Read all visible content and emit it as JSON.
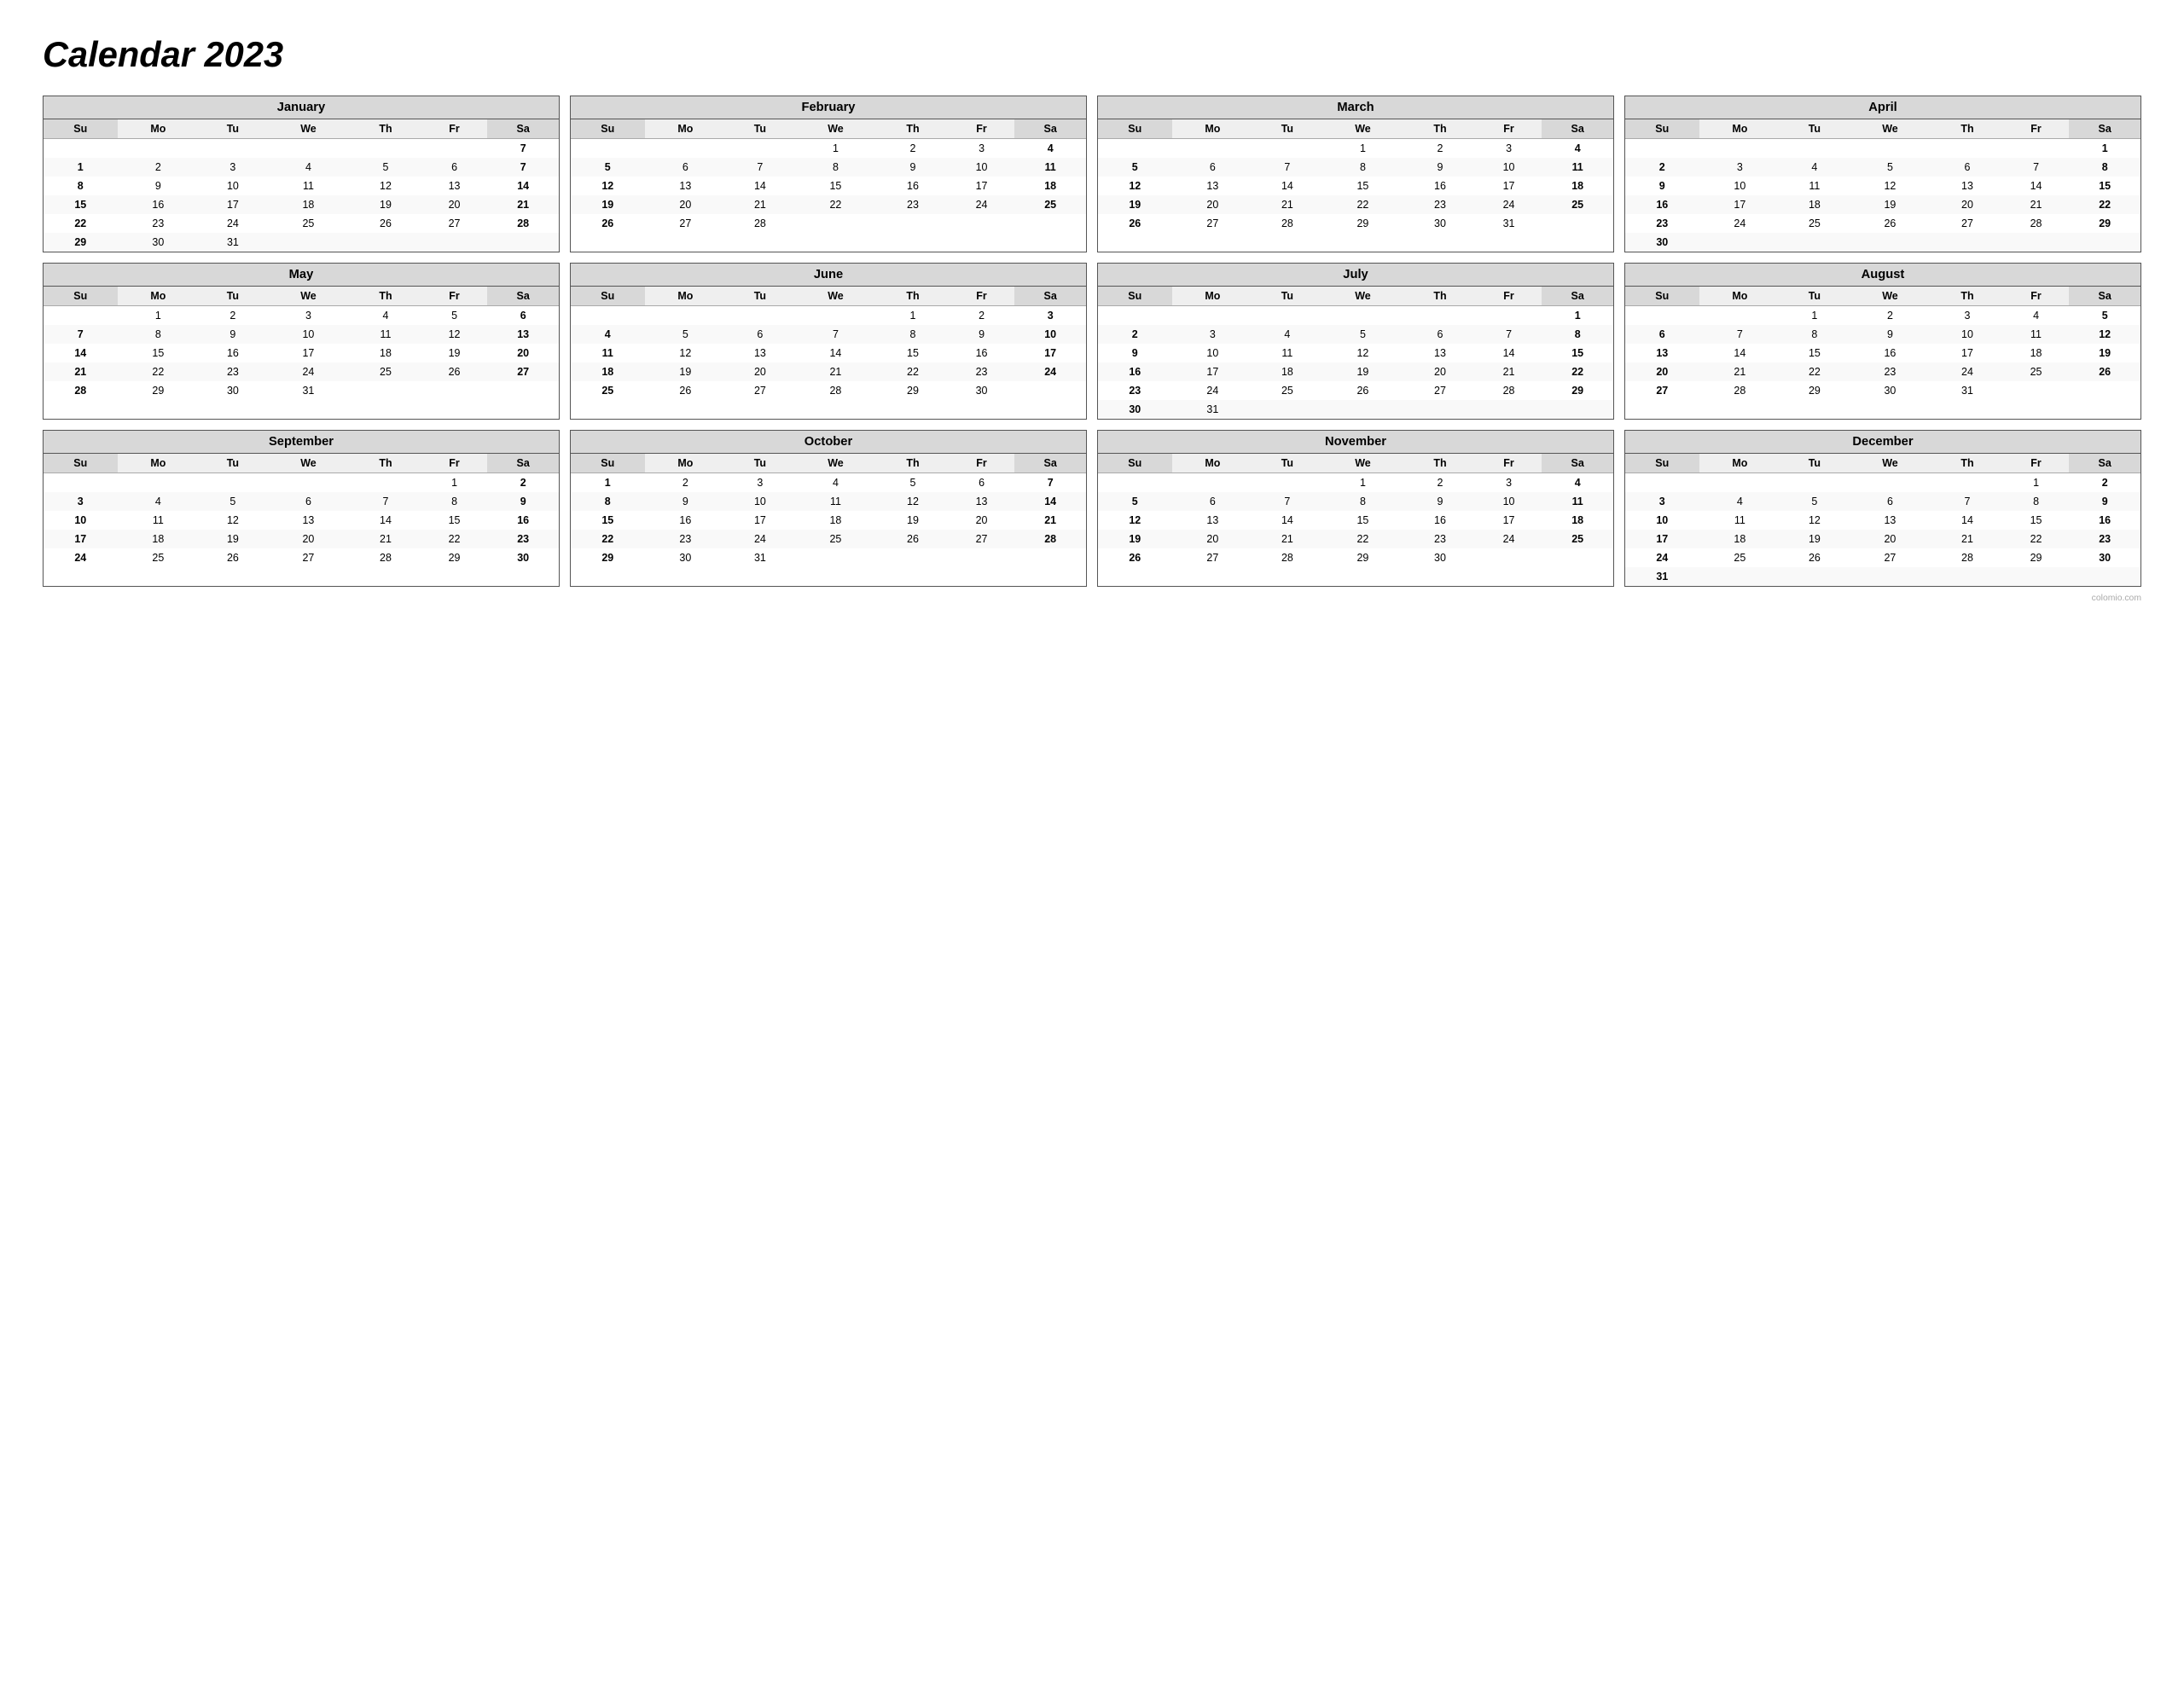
{
  "title": "Calendar 2023",
  "watermark": "colomio.com",
  "months": [
    {
      "name": "January",
      "weeks": [
        [
          "",
          "",
          "",
          "",
          "",
          "",
          "7"
        ],
        [
          "1",
          "2",
          "3",
          "4",
          "5",
          "6",
          "7"
        ],
        [
          "8",
          "9",
          "10",
          "11",
          "12",
          "13",
          "14"
        ],
        [
          "15",
          "16",
          "17",
          "18",
          "19",
          "20",
          "21"
        ],
        [
          "22",
          "23",
          "24",
          "25",
          "26",
          "27",
          "28"
        ],
        [
          "29",
          "30",
          "31",
          "",
          "",
          "",
          ""
        ]
      ],
      "start_day": 0,
      "days": [
        1,
        2,
        3,
        4,
        5,
        6,
        7,
        8,
        9,
        10,
        11,
        12,
        13,
        14,
        15,
        16,
        17,
        18,
        19,
        20,
        21,
        22,
        23,
        24,
        25,
        26,
        27,
        28,
        29,
        30,
        31
      ]
    },
    {
      "name": "February",
      "weeks": [
        [
          "",
          "",
          "",
          "1",
          "2",
          "3",
          "4"
        ],
        [
          "5",
          "6",
          "7",
          "8",
          "9",
          "10",
          "11"
        ],
        [
          "12",
          "13",
          "14",
          "15",
          "16",
          "17",
          "18"
        ],
        [
          "19",
          "20",
          "21",
          "22",
          "23",
          "24",
          "25"
        ],
        [
          "26",
          "27",
          "28",
          "",
          "",
          "",
          ""
        ]
      ]
    },
    {
      "name": "March",
      "weeks": [
        [
          "",
          "",
          "",
          "1",
          "2",
          "3",
          "4"
        ],
        [
          "5",
          "6",
          "7",
          "8",
          "9",
          "10",
          "11"
        ],
        [
          "12",
          "13",
          "14",
          "15",
          "16",
          "17",
          "18"
        ],
        [
          "19",
          "20",
          "21",
          "22",
          "23",
          "24",
          "25"
        ],
        [
          "26",
          "27",
          "28",
          "29",
          "30",
          "31",
          ""
        ]
      ]
    },
    {
      "name": "April",
      "weeks": [
        [
          "",
          "",
          "",
          "",
          "",
          "",
          "1"
        ],
        [
          "2",
          "3",
          "4",
          "5",
          "6",
          "7",
          "8"
        ],
        [
          "9",
          "10",
          "11",
          "12",
          "13",
          "14",
          "15"
        ],
        [
          "16",
          "17",
          "18",
          "19",
          "20",
          "21",
          "22"
        ],
        [
          "23",
          "24",
          "25",
          "26",
          "27",
          "28",
          "29"
        ],
        [
          "30",
          "",
          "",
          "",
          "",
          "",
          ""
        ]
      ]
    },
    {
      "name": "May",
      "weeks": [
        [
          "",
          "1",
          "2",
          "3",
          "4",
          "5",
          "6"
        ],
        [
          "7",
          "8",
          "9",
          "10",
          "11",
          "12",
          "13"
        ],
        [
          "14",
          "15",
          "16",
          "17",
          "18",
          "19",
          "20"
        ],
        [
          "21",
          "22",
          "23",
          "24",
          "25",
          "26",
          "27"
        ],
        [
          "28",
          "29",
          "30",
          "31",
          "",
          "",
          ""
        ]
      ]
    },
    {
      "name": "June",
      "weeks": [
        [
          "",
          "",
          "",
          "",
          "1",
          "2",
          "3"
        ],
        [
          "4",
          "5",
          "6",
          "7",
          "8",
          "9",
          "10"
        ],
        [
          "11",
          "12",
          "13",
          "14",
          "15",
          "16",
          "17"
        ],
        [
          "18",
          "19",
          "20",
          "21",
          "22",
          "23",
          "24"
        ],
        [
          "25",
          "26",
          "27",
          "28",
          "29",
          "30",
          ""
        ]
      ]
    },
    {
      "name": "July",
      "weeks": [
        [
          "",
          "",
          "",
          "",
          "",
          "",
          "1"
        ],
        [
          "2",
          "3",
          "4",
          "5",
          "6",
          "7",
          "8"
        ],
        [
          "9",
          "10",
          "11",
          "12",
          "13",
          "14",
          "15"
        ],
        [
          "16",
          "17",
          "18",
          "19",
          "20",
          "21",
          "22"
        ],
        [
          "23",
          "24",
          "25",
          "26",
          "27",
          "28",
          "29"
        ],
        [
          "30",
          "31",
          "",
          "",
          "",
          "",
          ""
        ]
      ]
    },
    {
      "name": "August",
      "weeks": [
        [
          "",
          "",
          "1",
          "2",
          "3",
          "4",
          "5"
        ],
        [
          "6",
          "7",
          "8",
          "9",
          "10",
          "11",
          "12"
        ],
        [
          "13",
          "14",
          "15",
          "16",
          "17",
          "18",
          "19"
        ],
        [
          "20",
          "21",
          "22",
          "23",
          "24",
          "25",
          "26"
        ],
        [
          "27",
          "28",
          "29",
          "30",
          "31",
          "",
          ""
        ]
      ]
    },
    {
      "name": "September",
      "weeks": [
        [
          "",
          "",
          "",
          "",
          "",
          "1",
          "2"
        ],
        [
          "3",
          "4",
          "5",
          "6",
          "7",
          "8",
          "9"
        ],
        [
          "10",
          "11",
          "12",
          "13",
          "14",
          "15",
          "16"
        ],
        [
          "17",
          "18",
          "19",
          "20",
          "21",
          "22",
          "23"
        ],
        [
          "24",
          "25",
          "26",
          "27",
          "28",
          "29",
          "30"
        ]
      ]
    },
    {
      "name": "October",
      "weeks": [
        [
          "1",
          "2",
          "3",
          "4",
          "5",
          "6",
          "7"
        ],
        [
          "8",
          "9",
          "10",
          "11",
          "12",
          "13",
          "14"
        ],
        [
          "15",
          "16",
          "17",
          "18",
          "19",
          "20",
          "21"
        ],
        [
          "22",
          "23",
          "24",
          "25",
          "26",
          "27",
          "28"
        ],
        [
          "29",
          "30",
          "31",
          "",
          "",
          "",
          ""
        ]
      ]
    },
    {
      "name": "November",
      "weeks": [
        [
          "",
          "",
          "",
          "1",
          "2",
          "3",
          "4"
        ],
        [
          "5",
          "6",
          "7",
          "8",
          "9",
          "10",
          "11"
        ],
        [
          "12",
          "13",
          "14",
          "15",
          "16",
          "17",
          "18"
        ],
        [
          "19",
          "20",
          "21",
          "22",
          "23",
          "24",
          "25"
        ],
        [
          "26",
          "27",
          "28",
          "29",
          "30",
          "",
          ""
        ]
      ]
    },
    {
      "name": "December",
      "weeks": [
        [
          "",
          "",
          "",
          "",
          "",
          "1",
          "2"
        ],
        [
          "3",
          "4",
          "5",
          "6",
          "7",
          "8",
          "9"
        ],
        [
          "10",
          "11",
          "12",
          "13",
          "14",
          "15",
          "16"
        ],
        [
          "17",
          "18",
          "19",
          "20",
          "21",
          "22",
          "23"
        ],
        [
          "24",
          "25",
          "26",
          "27",
          "28",
          "29",
          "30"
        ],
        [
          "31",
          "",
          "",
          "",
          "",
          "",
          ""
        ]
      ]
    }
  ],
  "days_header": [
    "Su",
    "Mo",
    "Tu",
    "We",
    "Th",
    "Fr",
    "Sa"
  ]
}
